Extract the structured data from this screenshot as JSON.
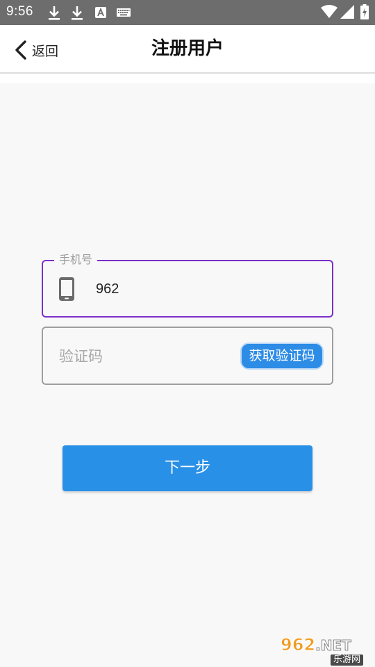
{
  "status_bar": {
    "time": "9:56",
    "icons": [
      "download-icon",
      "download-icon",
      "text-a-icon",
      "keyboard-icon",
      "wifi-icon",
      "signal-icon",
      "battery-charging-icon"
    ]
  },
  "header": {
    "back_label": "返回",
    "title": "注册用户"
  },
  "form": {
    "phone": {
      "label": "手机号",
      "value": "962",
      "icon": "smartphone-icon"
    },
    "code": {
      "placeholder": "验证码",
      "get_code_label": "获取验证码"
    },
    "next_label": "下一步"
  },
  "watermark": {
    "brand": "962",
    "suffix": ".NET",
    "sub": "乐游网"
  },
  "colors": {
    "status_bar": "#6d6d6d",
    "focus_border": "#7a2fc9",
    "primary_button": "#2990e7",
    "page_background": "#f8f8f8"
  }
}
